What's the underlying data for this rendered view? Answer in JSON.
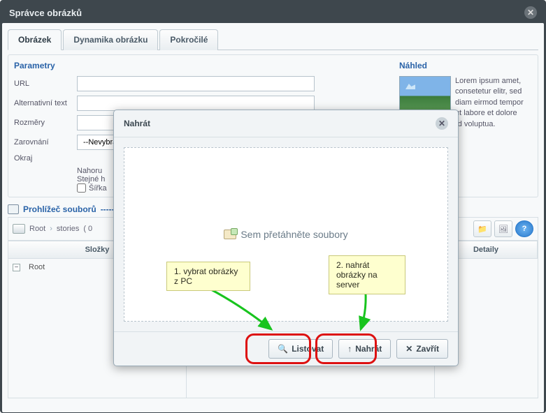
{
  "main": {
    "title": "Správce obrázků"
  },
  "tabs": [
    {
      "label": "Obrázek",
      "active": true
    },
    {
      "label": "Dynamika obrázku",
      "active": false
    },
    {
      "label": "Pokročilé",
      "active": false
    }
  ],
  "params": {
    "heading": "Parametry",
    "url_label": "URL",
    "alt_label": "Alternativní text",
    "dim_label": "Rozměry",
    "align_label": "Zarovnání",
    "align_value": "--Nevybráno--",
    "border_label": "Okraj",
    "vsp_top": "Nahoru",
    "vsp_same": "Stejné h",
    "chk_width": "Šířka"
  },
  "preview": {
    "heading": "Náhled",
    "text": "Lorem ipsum amet, consetetur elitr, sed diam eirmod tempor ut labore et dolore aliquyam erat, sed voluptua."
  },
  "fb": {
    "title": "Prohlížeč souborů",
    "path_root": "Root",
    "path_sub": "stories",
    "path_count": "( 0",
    "col_folders": "Složky",
    "col_content": "",
    "col_details": "Detaily",
    "root_label": "Root"
  },
  "upload": {
    "title": "Nahrát",
    "dropzone": "Sem přetáhněte soubory",
    "browse": "Listovat",
    "upload": "Nahrát",
    "close": "Zavřít"
  },
  "callouts": {
    "c1": "1. vybrat obrázky z PC",
    "c2": "2. nahrát obrázky na server"
  }
}
